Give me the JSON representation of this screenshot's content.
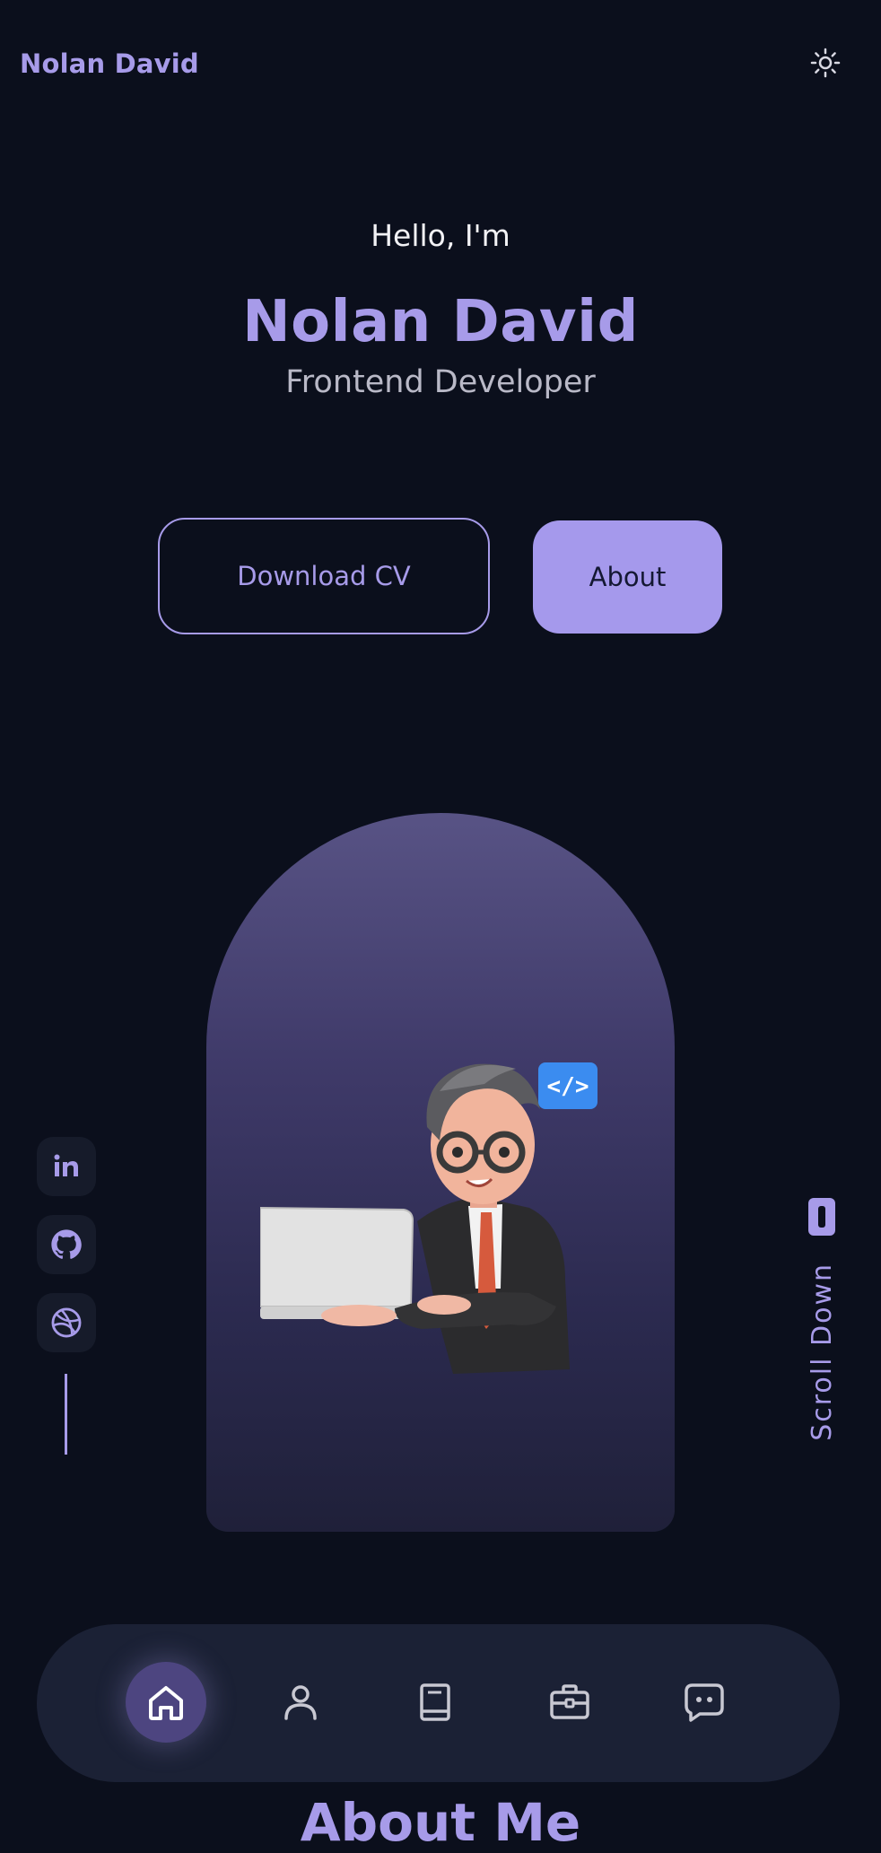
{
  "header": {
    "brand": "Nolan David",
    "theme_toggle_icon": "sun-icon"
  },
  "hero": {
    "greeting": "Hello, I'm",
    "name": "Nolan David",
    "role": "Frontend Developer",
    "buttons": {
      "download_cv": "Download CV",
      "about": "About"
    },
    "image": "developer-avatar-with-laptop"
  },
  "social": {
    "items": [
      {
        "name": "linkedin-icon",
        "label": "in"
      },
      {
        "name": "github-icon"
      },
      {
        "name": "dribbble-icon"
      }
    ]
  },
  "scroll": {
    "label": "Scroll Down",
    "icon": "mouse-icon"
  },
  "nav": {
    "items": [
      {
        "icon": "home-icon",
        "active": true
      },
      {
        "icon": "user-icon",
        "active": false
      },
      {
        "icon": "book-icon",
        "active": false
      },
      {
        "icon": "briefcase-icon",
        "active": false
      },
      {
        "icon": "chat-icon",
        "active": false
      }
    ]
  },
  "next_section": {
    "title": "About Me"
  },
  "colors": {
    "background": "#0b0f1c",
    "accent": "#a79be9",
    "nav_bg": "#1b2135",
    "card_bg": "#161b2a"
  }
}
